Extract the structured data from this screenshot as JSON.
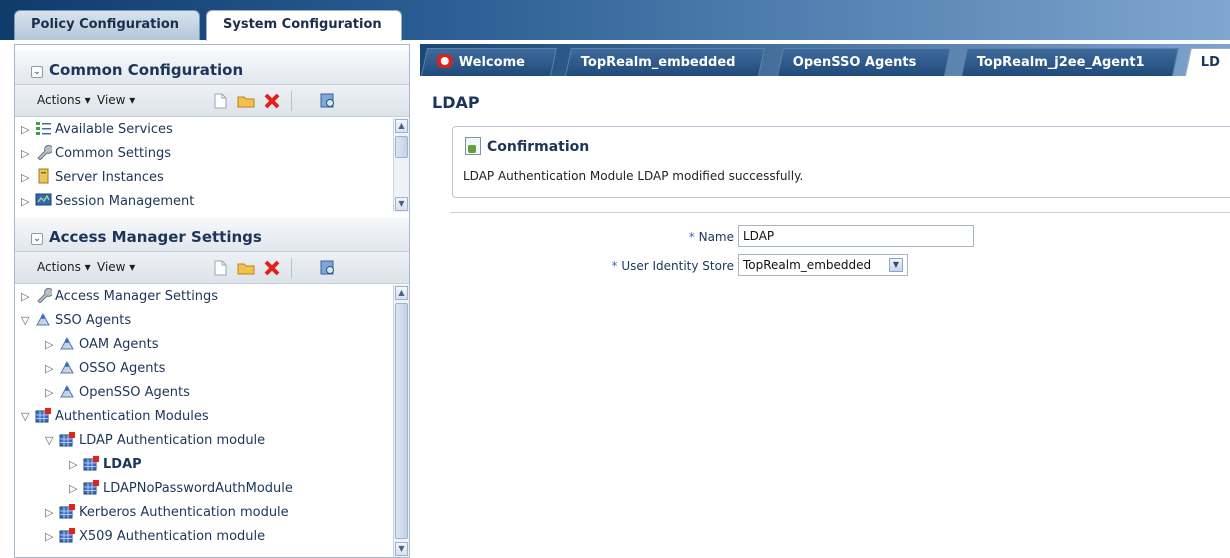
{
  "top_tabs": [
    {
      "label": "Policy Configuration"
    },
    {
      "label": "System Configuration"
    }
  ],
  "common": {
    "title": "Common Configuration",
    "toolbar": {
      "actions": "Actions",
      "view": "View"
    },
    "items": [
      {
        "label": "Available Services"
      },
      {
        "label": "Common Settings"
      },
      {
        "label": "Server Instances"
      },
      {
        "label": "Session Management"
      }
    ]
  },
  "access": {
    "title": "Access Manager Settings",
    "toolbar": {
      "actions": "Actions",
      "view": "View"
    },
    "items": [
      {
        "label": "Access Manager Settings"
      },
      {
        "label": "SSO Agents"
      },
      {
        "label": "OAM Agents"
      },
      {
        "label": "OSSO Agents"
      },
      {
        "label": "OpenSSO Agents"
      },
      {
        "label": "Authentication Modules"
      },
      {
        "label": "LDAP Authentication module"
      },
      {
        "label": "LDAP"
      },
      {
        "label": "LDAPNoPasswordAuthModule"
      },
      {
        "label": "Kerberos Authentication module"
      },
      {
        "label": "X509 Authentication module"
      }
    ]
  },
  "right_tabs": [
    {
      "label": "Welcome"
    },
    {
      "label": "TopRealm_embedded"
    },
    {
      "label": "OpenSSO Agents"
    },
    {
      "label": "TopRealm_j2ee_Agent1"
    },
    {
      "label": "LD"
    }
  ],
  "page": {
    "title": "LDAP",
    "confirmation": {
      "heading": "Confirmation",
      "message": "LDAP Authentication Module LDAP modified successfully."
    },
    "form": {
      "name_label": "Name",
      "name_value": "LDAP",
      "store_label": "User Identity Store",
      "store_value": "TopRealm_embedded",
      "required_marker": "*"
    }
  }
}
